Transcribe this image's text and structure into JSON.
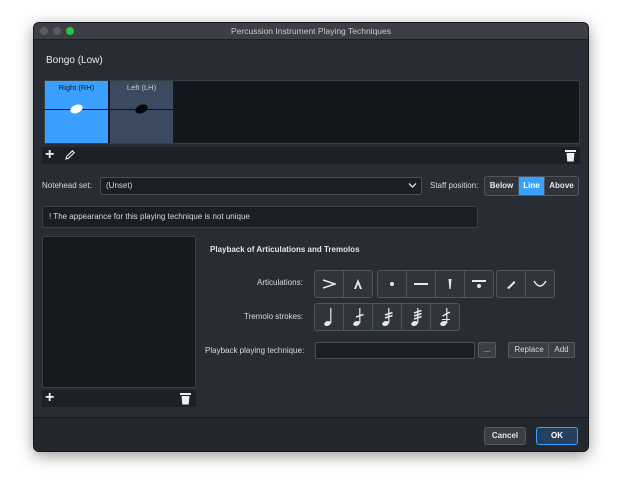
{
  "window": {
    "title": "Percussion Instrument Playing Techniques"
  },
  "instrument": {
    "name": "Bongo (Low)"
  },
  "techniques": [
    {
      "label": "Right (RH)",
      "selected": true
    },
    {
      "label": "Left (LH)",
      "selected": false
    }
  ],
  "toolbar": {
    "add_icon": "plus-icon",
    "edit_icon": "pencil-icon",
    "delete_icon": "trash-icon"
  },
  "notehead": {
    "label": "Notehead set:",
    "value": "(Unset)"
  },
  "staff_position": {
    "label": "Staff position:",
    "options": [
      "Below",
      "Line",
      "Above"
    ],
    "selected": "Line"
  },
  "warning": {
    "text": "! The appearance for this playing technique is not unique"
  },
  "playback": {
    "heading": "Playback of Articulations and Tremolos",
    "articulations_label": "Articulations:",
    "articulation_icons": [
      "accent-icon",
      "marcato-icon",
      "staccato-icon",
      "tenuto-icon",
      "staccatissimo-icon",
      "tenuto-staccato-icon",
      "stress-icon",
      "unstress-icon"
    ],
    "tremolo_label": "Tremolo strokes:",
    "tremolo_icons": [
      "quarter-note-icon",
      "tremolo-1-icon",
      "tremolo-2-icon",
      "tremolo-3-icon",
      "tremolo-4-icon"
    ],
    "technique_label": "Playback playing technique:",
    "technique_value": "",
    "browse_label": "...",
    "replace_label": "Replace",
    "add_label": "Add"
  },
  "footer": {
    "cancel_label": "Cancel",
    "ok_label": "OK"
  },
  "colors": {
    "accent": "#3aa0ff",
    "background": "#282d35"
  }
}
